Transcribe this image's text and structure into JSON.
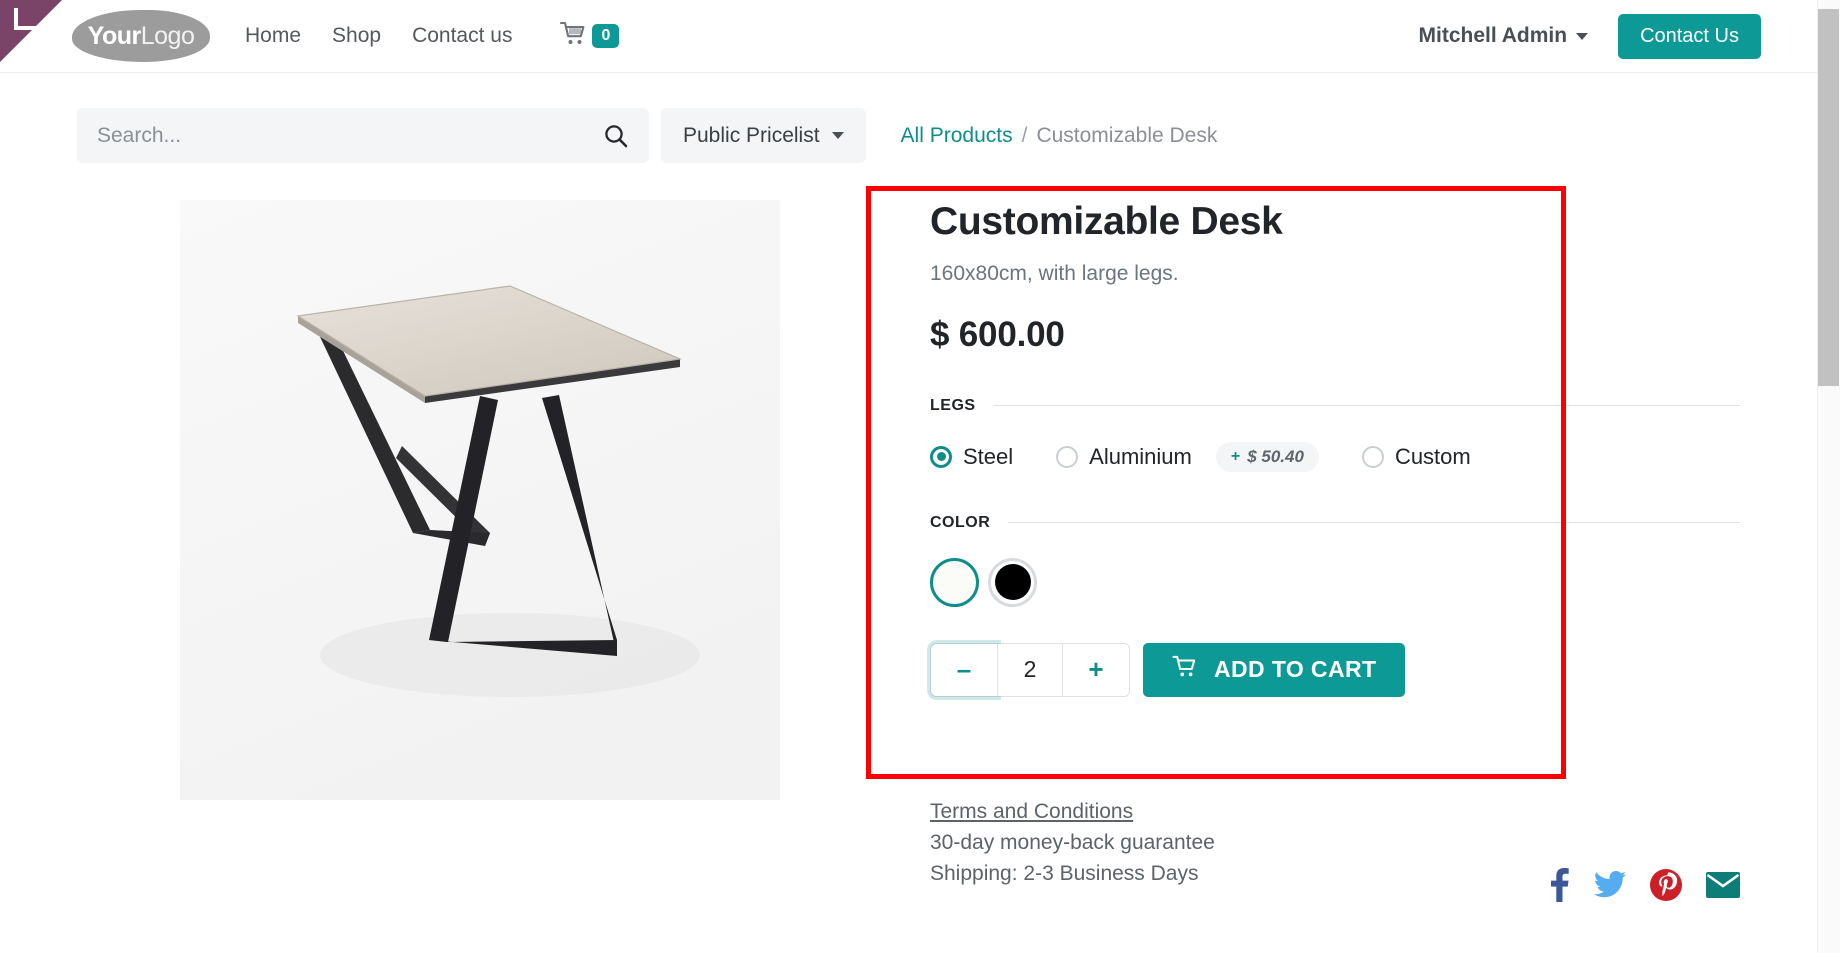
{
  "navbar": {
    "logo_bold": "Your",
    "logo_light": "Logo",
    "links": [
      {
        "label": "Home"
      },
      {
        "label": "Shop"
      },
      {
        "label": "Contact us"
      }
    ],
    "cart_count": "0",
    "cart_icon": "shopping-cart-icon",
    "user_name": "Mitchell Admin",
    "contact_button": "Contact Us",
    "accent_color": "#0d9a97"
  },
  "toolbar": {
    "search_placeholder": "Search...",
    "search_value": "",
    "search_icon": "search-icon",
    "pricelist_label": "Public Pricelist",
    "pricelist_caret": "chevron-down-icon"
  },
  "breadcrumb": {
    "root": "All Products",
    "separator": "/",
    "current": "Customizable Desk"
  },
  "product": {
    "image_alt": "Customizable Desk product photo",
    "title": "Customizable Desk",
    "subtitle": "160x80cm, with large legs.",
    "price": "$ 600.00",
    "attributes": [
      {
        "name": "LEGS",
        "type": "radio",
        "options": [
          {
            "label": "Steel",
            "selected": true,
            "extra_price": ""
          },
          {
            "label": "Aluminium",
            "selected": false,
            "extra_price": "$ 50.40",
            "extra_sign": "+"
          },
          {
            "label": "Custom",
            "selected": false,
            "extra_price": ""
          }
        ]
      },
      {
        "name": "COLOR",
        "type": "swatch",
        "options": [
          {
            "label": "White",
            "hex": "#fbfbf8",
            "selected": true
          },
          {
            "label": "Black",
            "hex": "#000000",
            "selected": false
          }
        ]
      }
    ],
    "quantity": {
      "decrease_label": "–",
      "value": "2",
      "increase_label": "+"
    },
    "add_to_cart_label": "ADD TO CART",
    "add_to_cart_icon": "shopping-cart-icon"
  },
  "footnotes": {
    "terms_link": "Terms and Conditions",
    "guarantee": "30-day money-back guarantee",
    "shipping": "Shipping: 2-3 Business Days"
  },
  "socials": [
    {
      "name": "facebook-icon",
      "color": "#3b5998"
    },
    {
      "name": "twitter-icon",
      "color": "#55acee"
    },
    {
      "name": "pinterest-icon",
      "color": "#cb2027"
    },
    {
      "name": "email-icon",
      "color": "#0d7d78"
    }
  ],
  "highlight": {
    "color": "#ff0000",
    "target": "product-configurator"
  }
}
